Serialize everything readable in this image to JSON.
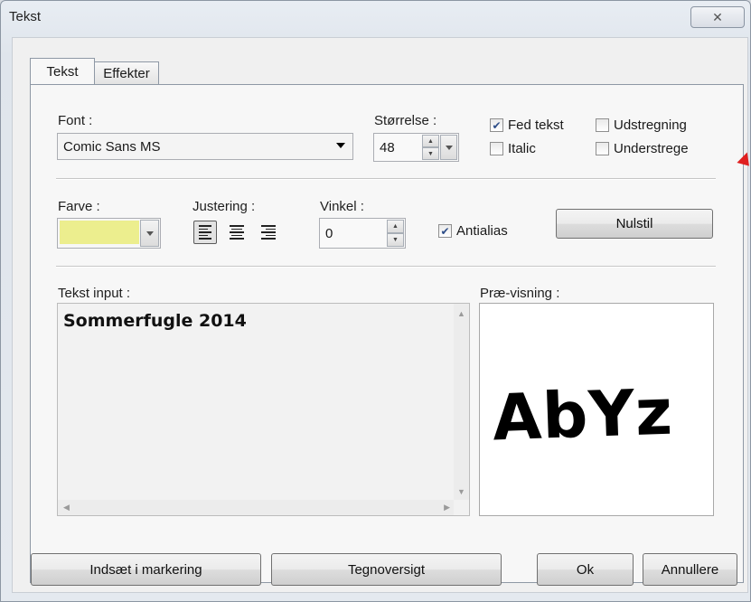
{
  "window": {
    "title": "Tekst",
    "close_glyph": "✕"
  },
  "tabs": [
    {
      "label": "Tekst"
    },
    {
      "label": "Effekter"
    }
  ],
  "font": {
    "label": "Font :",
    "value": "Comic Sans MS"
  },
  "size": {
    "label": "Størrelse :",
    "value": "48"
  },
  "checkboxes": {
    "bold": {
      "label": "Fed tekst",
      "checked": true
    },
    "italic": {
      "label": "Italic",
      "checked": false
    },
    "strike": {
      "label": "Udstregning",
      "checked": false
    },
    "underline": {
      "label": "Understrege",
      "checked": false
    },
    "antialias": {
      "label": "Antialias",
      "checked": true
    }
  },
  "color": {
    "label": "Farve :",
    "value": "#ecee8e"
  },
  "alignment": {
    "label": "Justering :",
    "options": [
      "left",
      "center",
      "right"
    ],
    "selected": "left"
  },
  "angle": {
    "label": "Vinkel :",
    "value": "0"
  },
  "reset_button": "Nulstil",
  "text_input": {
    "label": "Tekst input :",
    "value": "Sommerfugle 2014"
  },
  "preview": {
    "label": "Præ-visning :",
    "sample": "AbYz"
  },
  "buttons": {
    "insert": "Indsæt i markering",
    "charmap": "Tegnoversigt",
    "ok": "Ok",
    "cancel": "Annullere"
  }
}
